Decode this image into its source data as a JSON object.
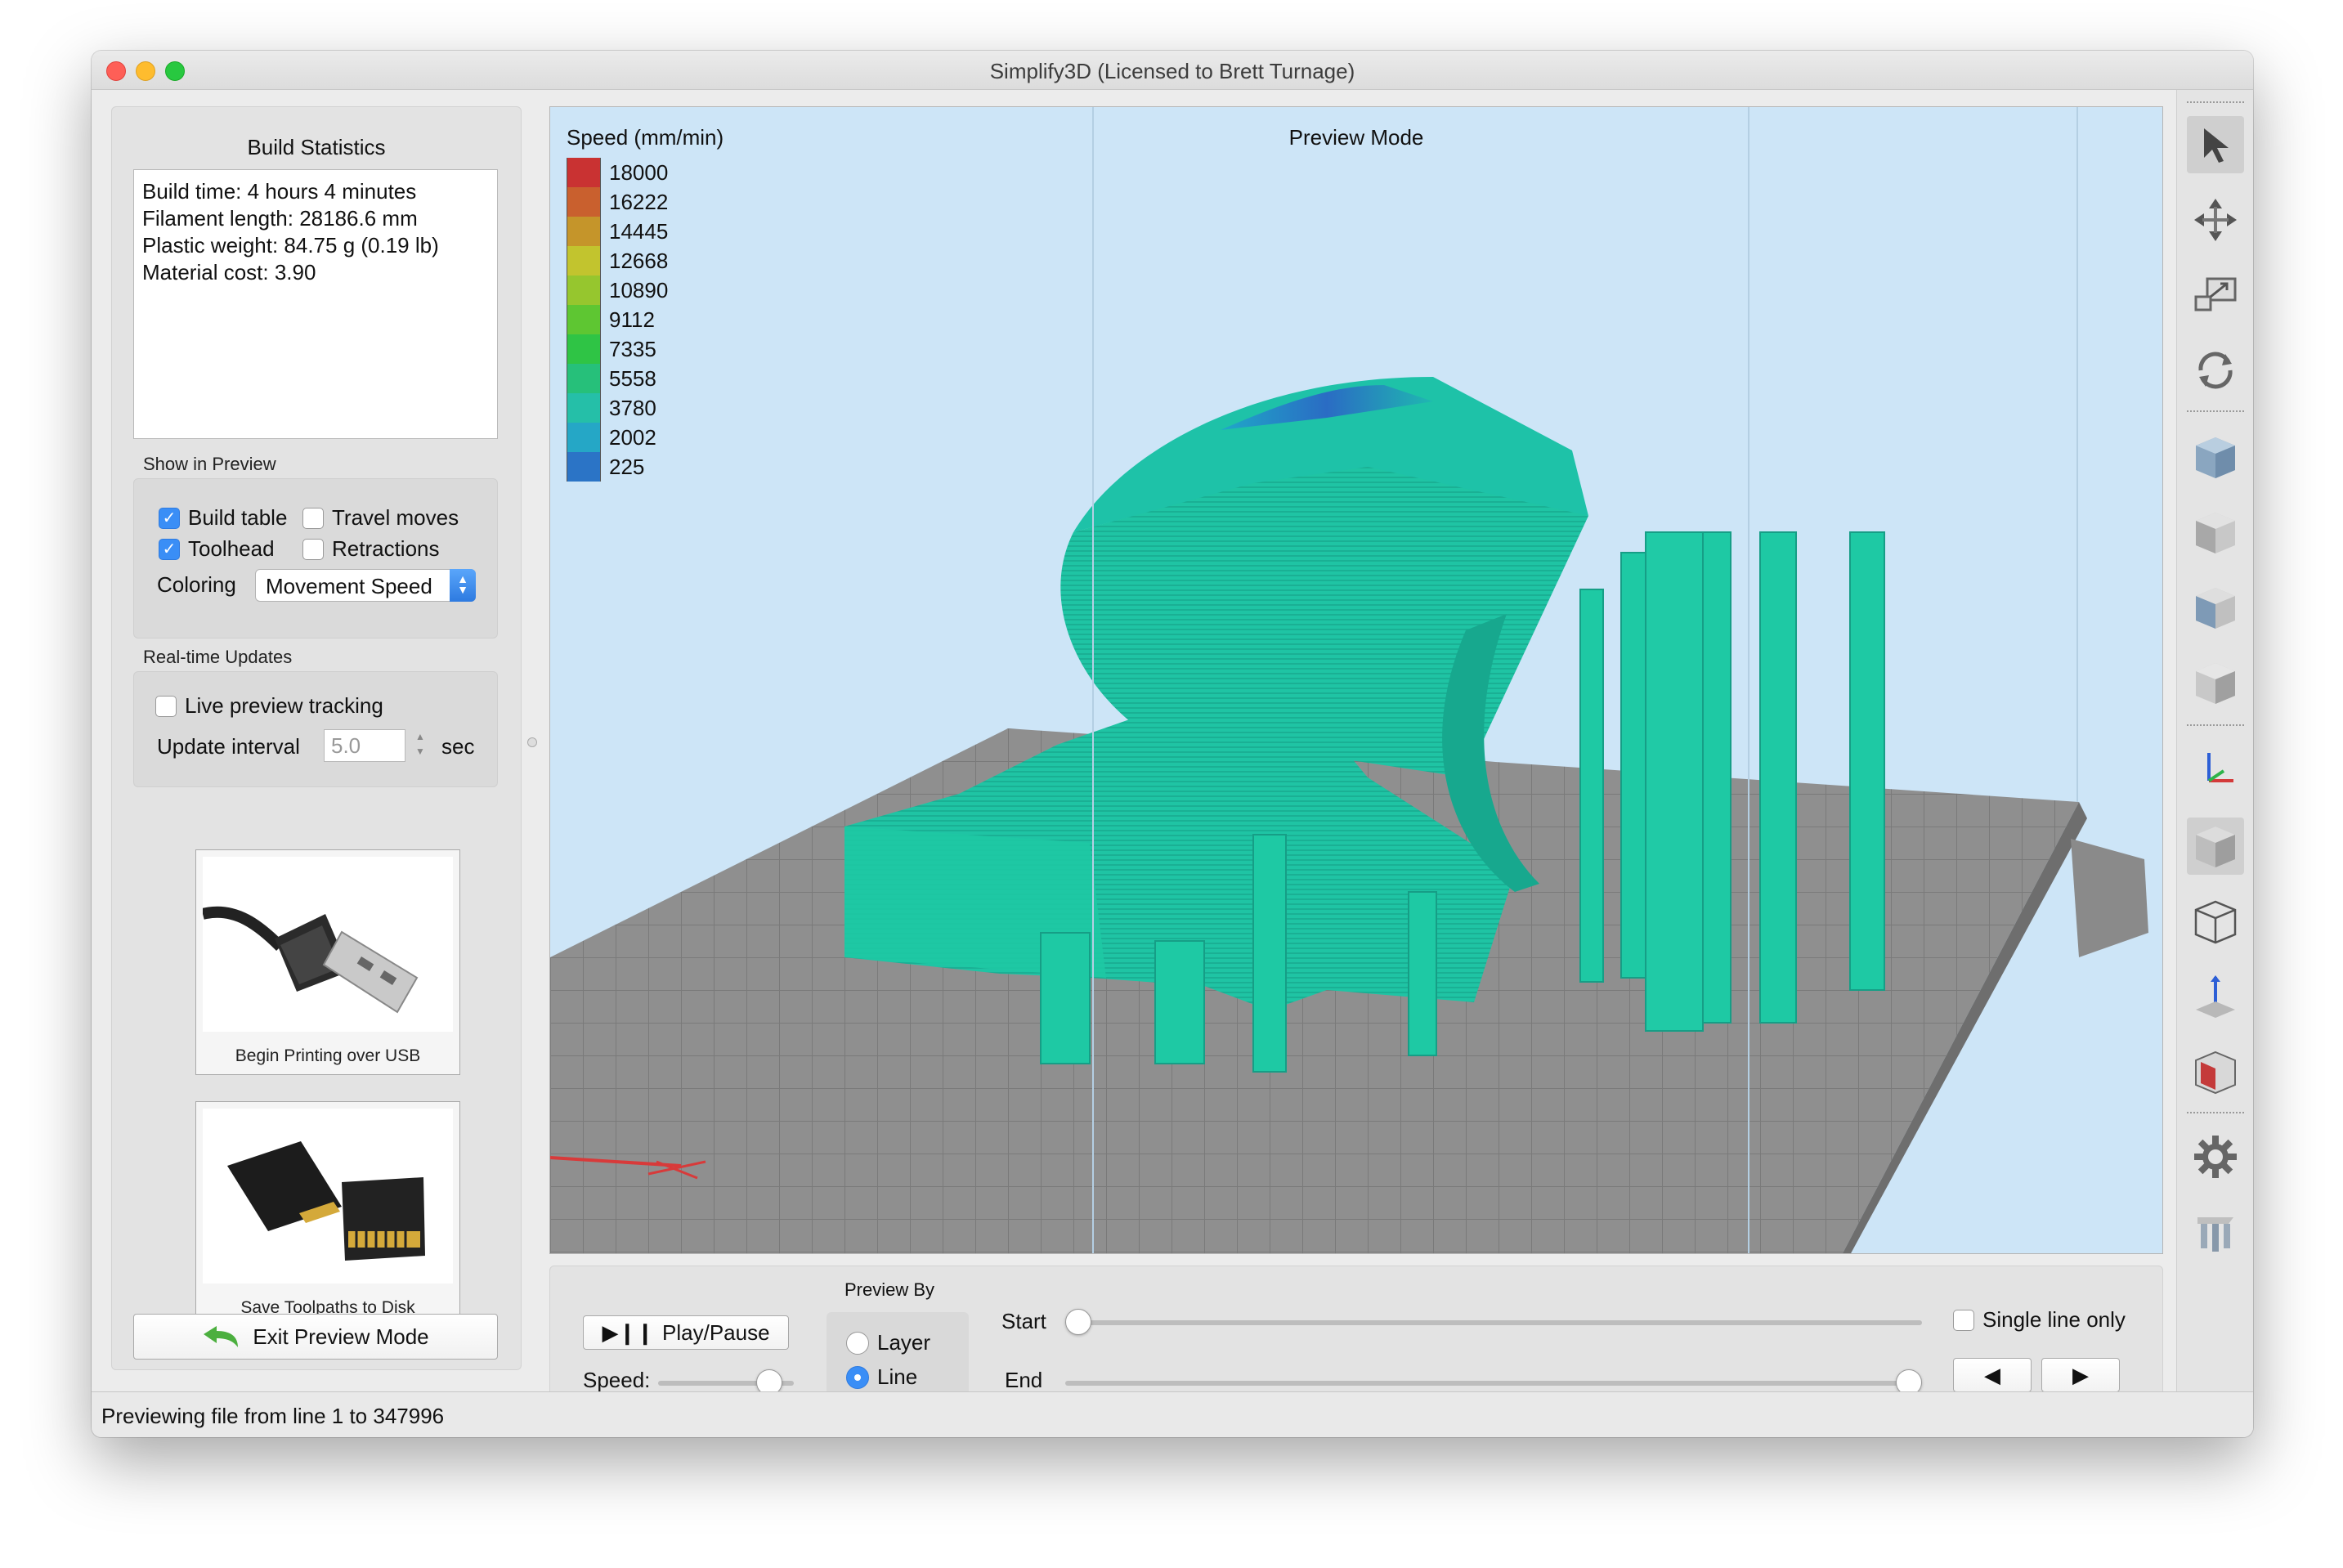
{
  "window": {
    "title": "Simplify3D (Licensed to Brett Turnage)"
  },
  "build_statistics": {
    "heading": "Build Statistics",
    "lines": [
      "Build time: 4 hours 4 minutes",
      "Filament length: 28186.6 mm",
      "Plastic weight: 84.75 g (0.19 lb)",
      "Material cost: 3.90"
    ]
  },
  "show_in_preview": {
    "label": "Show in Preview",
    "build_table": {
      "label": "Build table",
      "checked": true
    },
    "travel_moves": {
      "label": "Travel moves",
      "checked": false
    },
    "toolhead": {
      "label": "Toolhead",
      "checked": true
    },
    "retractions": {
      "label": "Retractions",
      "checked": false
    },
    "coloring_label": "Coloring",
    "coloring_value": "Movement Speed"
  },
  "realtime": {
    "label": "Real-time Updates",
    "live_tracking": {
      "label": "Live preview tracking",
      "checked": false
    },
    "interval_label": "Update interval",
    "interval_value": "5.0",
    "interval_unit": "sec"
  },
  "tiles": {
    "usb": "Begin Printing over USB",
    "disk": "Save Toolpaths to Disk"
  },
  "exit_button": "Exit Preview Mode",
  "viewport": {
    "mode": "Preview Mode",
    "legend_title": "Speed (mm/min)",
    "legend": [
      {
        "value": "18000",
        "color": "#c93232"
      },
      {
        "value": "16222",
        "color": "#c9602e"
      },
      {
        "value": "14445",
        "color": "#c5952a"
      },
      {
        "value": "12668",
        "color": "#c2c42e"
      },
      {
        "value": "10890",
        "color": "#96c62e"
      },
      {
        "value": "9112",
        "color": "#5ec632"
      },
      {
        "value": "7335",
        "color": "#2fc445"
      },
      {
        "value": "5558",
        "color": "#26c07a"
      },
      {
        "value": "3780",
        "color": "#25bfa8"
      },
      {
        "value": "2002",
        "color": "#25a7c6"
      },
      {
        "value": "225",
        "color": "#2b74c6"
      }
    ]
  },
  "controls": {
    "play_pause": "Play/Pause",
    "speed_label": "Speed:",
    "speed_level": 0.82,
    "preview_by_label": "Preview By",
    "layer": "Layer",
    "line": "Line",
    "selected": "Line",
    "start_label": "Start",
    "end_label": "End",
    "start_position": 0.0,
    "end_position": 1.0,
    "single_line": {
      "label": "Single line only",
      "checked": false
    }
  },
  "status": "Previewing file from line 1 to 347996"
}
